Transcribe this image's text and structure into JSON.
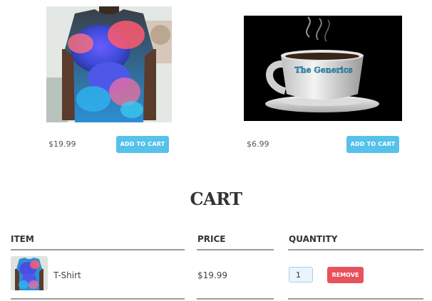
{
  "products": [
    {
      "name": "T-Shirt",
      "image_icon": "tshirt-photo",
      "price": "$19.99",
      "add_to_cart_label": "ADD TO CART"
    },
    {
      "name": "The Generics",
      "image_icon": "coffee-mug-photo",
      "image_text": "The Generics",
      "price": "$6.99",
      "add_to_cart_label": "ADD TO CART"
    }
  ],
  "cart": {
    "title": "CART",
    "headers": {
      "item": "ITEM",
      "price": "PRICE",
      "quantity": "QUANTITY"
    },
    "items": [
      {
        "name": "T-Shirt",
        "price": "$19.99",
        "quantity": "1",
        "remove_label": "REMOVE",
        "thumb_icon": "tshirt-thumbnail"
      }
    ]
  },
  "colors": {
    "button_blue": "#56c2ea",
    "remove_red": "#e8525c",
    "rule_gray": "#9a9a9a"
  }
}
